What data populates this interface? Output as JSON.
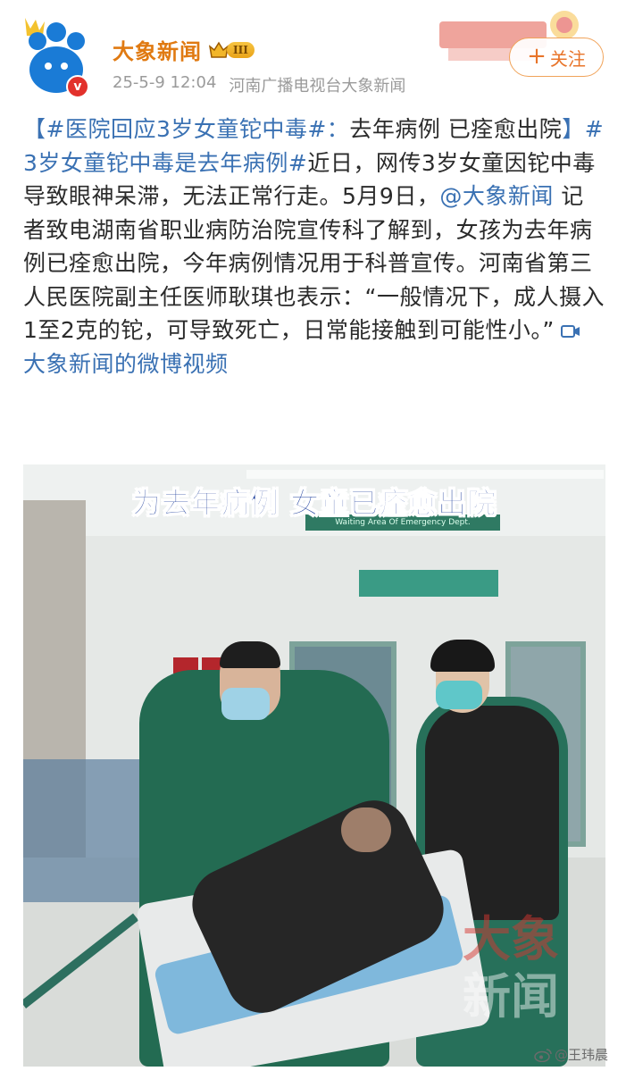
{
  "header": {
    "account_name": "大象新闻",
    "level_label": "III",
    "timestamp": "25-5-9 12:04",
    "source": "河南广播电视台大象新闻",
    "verified_label": "v",
    "follow_label": "关注"
  },
  "post": {
    "tag1": "【#医院回应3岁女童铊中毒#：",
    "text1": "去年病例 已痊愈出院",
    "tag2": "】#3岁女童铊中毒是去年病例#",
    "text2": "近日，网传3岁女童因铊中毒导致眼神呆滞，无法正常行走。5月9日，",
    "mention": "@大象新闻",
    "text3": " 记者致电湖南省职业病防治院宣传科了解到，女孩为去年病例已痊愈出院，今年病例情况用于科普宣传。河南省第三人民医院副主任医师耿琪也表示：“一般情况下，成人摄入1至2克的铊，可导致死亡，日常能接触到可能性小。”",
    "video_link": "大象新闻的微博视频"
  },
  "video": {
    "caption": "为去年病例 女童已痊愈出院",
    "sign_text": "Waiting Area Of Emergency Dept.",
    "watermark_line1": "大象",
    "watermark_line2": "新闻"
  },
  "page_watermark": "@王玮晨",
  "colors": {
    "accent_orange": "#e07a12",
    "link_blue": "#3a71b3",
    "follow_border": "#f0a35a",
    "caption_blue": "#1e3f9c"
  },
  "icons": [
    "paw-avatar-icon",
    "verified-v-icon",
    "crown-icon",
    "plus-icon",
    "video-link-icon",
    "weibo-logo-icon"
  ]
}
